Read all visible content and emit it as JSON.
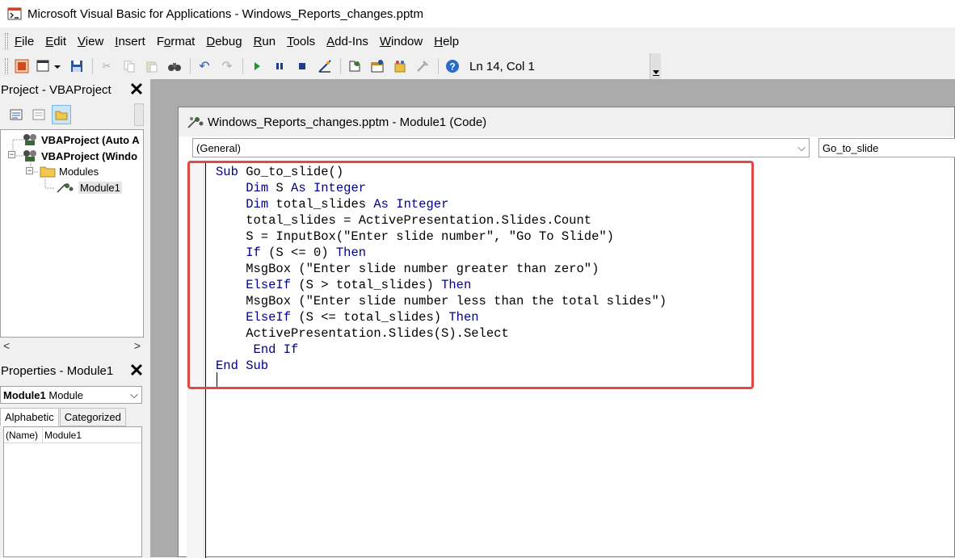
{
  "window": {
    "title": "Microsoft Visual Basic for Applications - Windows_Reports_changes.pptm"
  },
  "menu": [
    "File",
    "Edit",
    "View",
    "Insert",
    "Format",
    "Debug",
    "Run",
    "Tools",
    "Add-Ins",
    "Window",
    "Help"
  ],
  "menu_underline": [
    "F",
    "E",
    "V",
    "I",
    "o",
    "D",
    "R",
    "T",
    "A",
    "W",
    "H"
  ],
  "toolbar": {
    "status": "Ln 14, Col 1"
  },
  "project": {
    "title": "Project - VBAProject",
    "tree": {
      "node1": "VBAProject (Auto A",
      "node2": "VBAProject (Windo",
      "modules": "Modules",
      "module1": "Module1"
    }
  },
  "properties": {
    "title": "Properties - Module1",
    "object_name": "Module1",
    "object_type": "Module",
    "tab_alphabetic": "Alphabetic",
    "tab_categorized": "Categorized",
    "rows": [
      {
        "key": "(Name)",
        "value": "Module1"
      }
    ]
  },
  "code_window": {
    "title": "Windows_Reports_changes.pptm - Module1 (Code)",
    "object_combo": "(General)",
    "proc_combo": "Go_to_slide"
  },
  "code_lines": [
    [
      [
        "kw",
        "Sub"
      ],
      [
        "t",
        " Go_to_slide()"
      ]
    ],
    [
      [
        "t",
        "    "
      ],
      [
        "kw",
        "Dim"
      ],
      [
        "t",
        " S "
      ],
      [
        "kw",
        "As"
      ],
      [
        "t",
        " "
      ],
      [
        "kw",
        "Integer"
      ]
    ],
    [
      [
        "t",
        "    "
      ],
      [
        "kw",
        "Dim"
      ],
      [
        "t",
        " total_slides "
      ],
      [
        "kw",
        "As"
      ],
      [
        "t",
        " "
      ],
      [
        "kw",
        "Integer"
      ]
    ],
    [
      [
        "t",
        "    total_slides = ActivePresentation.Slides.Count"
      ]
    ],
    [
      [
        "t",
        "    S = InputBox(\"Enter slide number\", \"Go To Slide\")"
      ]
    ],
    [
      [
        "t",
        "    "
      ],
      [
        "kw",
        "If"
      ],
      [
        "t",
        " (S <= 0) "
      ],
      [
        "kw",
        "Then"
      ]
    ],
    [
      [
        "t",
        "    MsgBox (\"Enter slide number greater than zero\")"
      ]
    ],
    [
      [
        "t",
        "    "
      ],
      [
        "kw",
        "ElseIf"
      ],
      [
        "t",
        " (S > total_slides) "
      ],
      [
        "kw",
        "Then"
      ]
    ],
    [
      [
        "t",
        "    MsgBox (\"Enter slide number less than the total slides\")"
      ]
    ],
    [
      [
        "t",
        "    "
      ],
      [
        "kw",
        "ElseIf"
      ],
      [
        "t",
        " (S <= total_slides) "
      ],
      [
        "kw",
        "Then"
      ]
    ],
    [
      [
        "t",
        "    ActivePresentation.Slides(S).Select"
      ]
    ],
    [
      [
        "t",
        "     "
      ],
      [
        "kw",
        "End If"
      ]
    ],
    [
      [
        "kw",
        "End Sub"
      ]
    ]
  ],
  "colors": {
    "keyword": "#00008b",
    "highlight_border": "#e04848",
    "mdi_background": "#ababab"
  }
}
